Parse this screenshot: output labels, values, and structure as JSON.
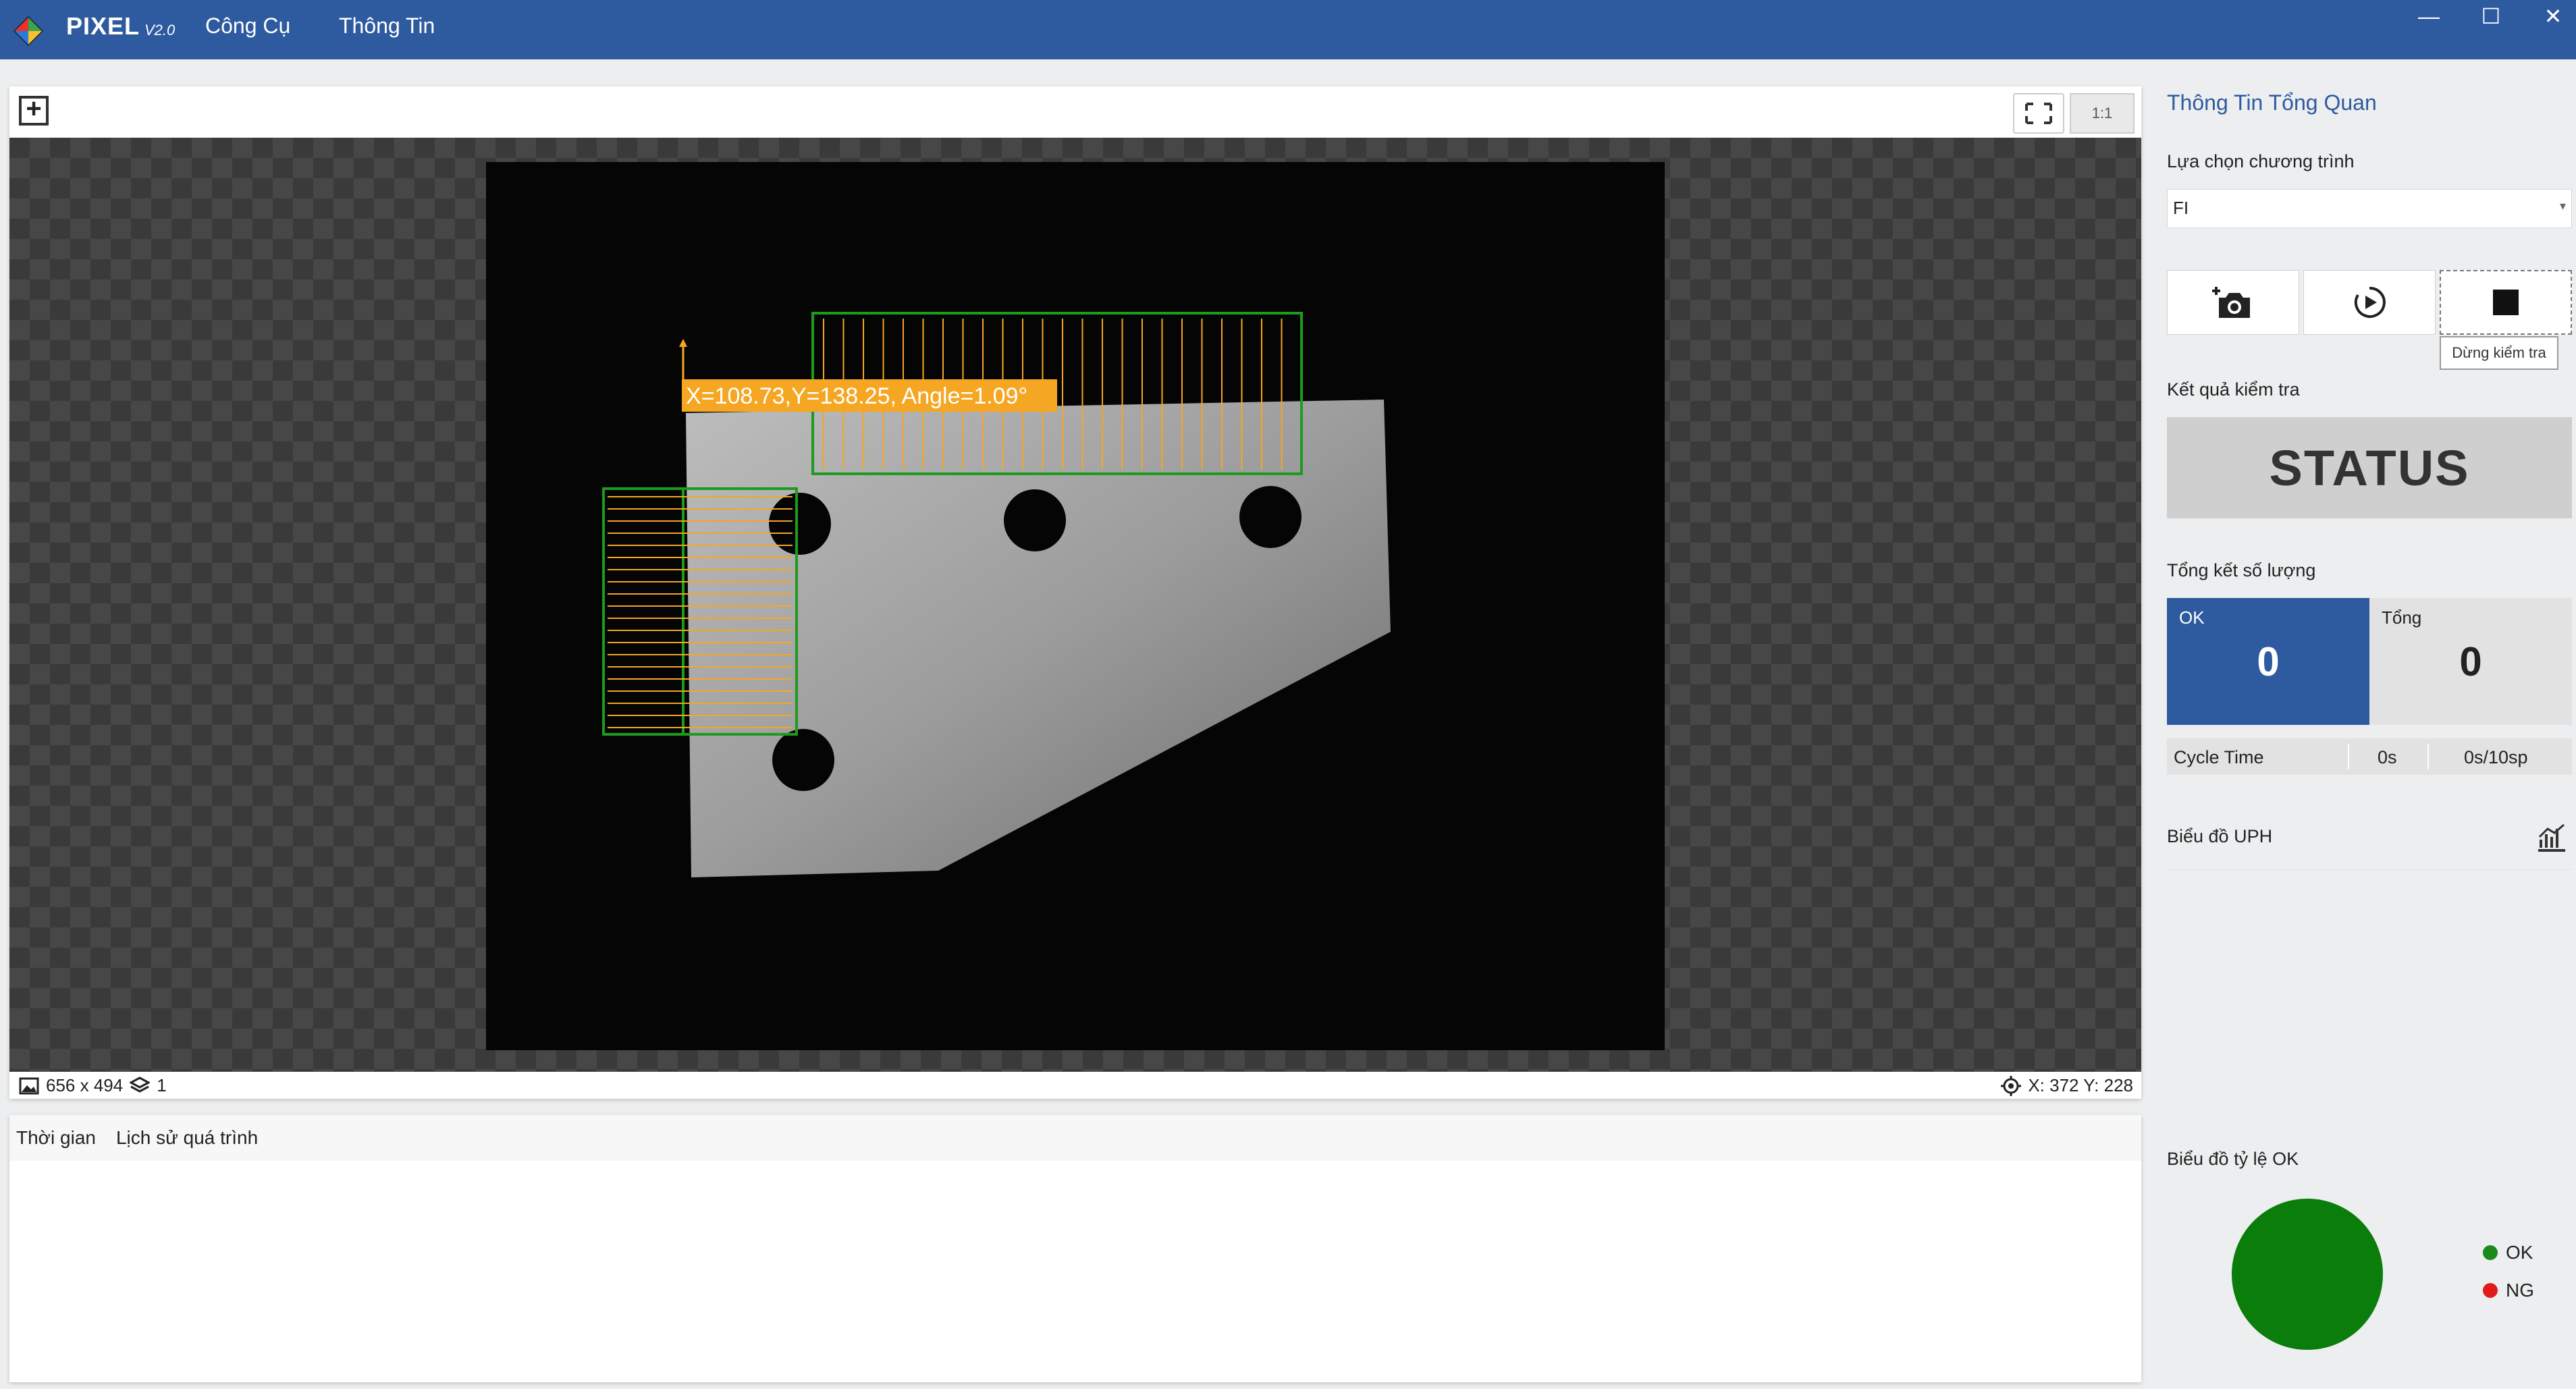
{
  "app": {
    "name": "PIXEL",
    "version": "V2.0"
  },
  "menu": [
    {
      "label": "Công Cụ"
    },
    {
      "label": "Thông Tin"
    }
  ],
  "window_controls": {
    "minimize": "—",
    "maximize": "☐",
    "close": "✕"
  },
  "viewer": {
    "ratio_label": "1:1",
    "overlay_text": "X=108.73,Y=138.25, Angle=1.09°",
    "image_size": "656 x 494",
    "layer_count": "1",
    "cursor_position": "X: 372 Y: 228"
  },
  "history": {
    "columns": [
      "Thời gian",
      "Lịch sử quá trình"
    ]
  },
  "right_panel": {
    "title": "Thông Tin Tổng Quan",
    "program_label": "Lựa chọn chương trình",
    "program_value": "FI",
    "stop_tooltip": "Dừng kiểm tra",
    "result_label": "Kết quả kiểm tra",
    "status_text": "STATUS",
    "summary_label": "Tổng kết số lượng",
    "ok_label": "OK",
    "ok_count": "0",
    "total_label": "Tổng",
    "total_count": "0",
    "cycle_label": "Cycle Time",
    "cycle_time": "0s",
    "cycle_rate": "0s/10sp",
    "uph_label": "Biểu đồ UPH",
    "ok_ratio_label": "Biểu đồ tỷ lệ OK",
    "legend": [
      {
        "label": "OK",
        "color": "#1a8a1a"
      },
      {
        "label": "NG",
        "color": "#e11b1b"
      }
    ]
  },
  "colors": {
    "accent": "#2e5aa0",
    "roi_box": "#1e9a1e",
    "roi_arrow": "#f5a623",
    "pie_ok": "#0a7d0a"
  },
  "chart_data": {
    "type": "pie",
    "title": "Biểu đồ tỷ lệ OK",
    "categories": [
      "OK",
      "NG"
    ],
    "values": [
      1,
      0
    ]
  }
}
